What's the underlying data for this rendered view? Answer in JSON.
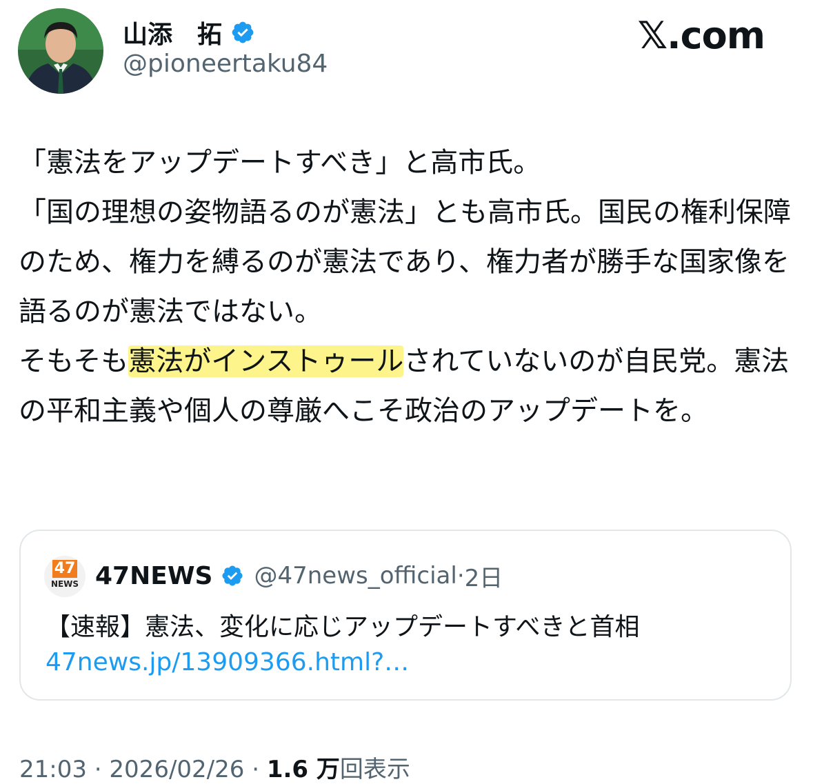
{
  "author": {
    "display_name": "山添　拓",
    "handle": "@pioneertaku84",
    "verified_icon": "verified-badge-icon"
  },
  "site_logo": "𝕏.com",
  "tweet": {
    "lines": [
      {
        "text": "「憲法をアップデートすべき」と高市氏。"
      },
      {
        "text": "「国の理想の姿物語るのが憲法」とも高市氏。国民の権利保障のため、権力を縛るのが憲法であり、権力者が勝手な国家像を語るのが憲法ではない。"
      },
      {
        "before": "そもそも",
        "highlight": "憲法がインストゥール",
        "after": "されていないのが自民党。憲法の平和主義や個人の尊厳へこそ政治のアップデートを。"
      }
    ],
    "highlight_color": "#fdf48c"
  },
  "quote": {
    "logo_number": "47",
    "logo_word": "NEWS",
    "name": "47NEWS",
    "handle": "@47news_official",
    "separator": "·",
    "age": "2日",
    "text": "【速報】憲法、変化に応じアップデートすべきと首相",
    "link": "47news.jp/13909366.html?…"
  },
  "footer": {
    "time": "21:03",
    "separator": "·",
    "date": "2026/02/26",
    "views_count": "1.6 万",
    "views_label": "回表示"
  },
  "colors": {
    "verified_blue": "#1d9bf0",
    "secondary_text": "#536471",
    "link": "#1d9bf0",
    "logo_orange": "#f07c1e"
  }
}
